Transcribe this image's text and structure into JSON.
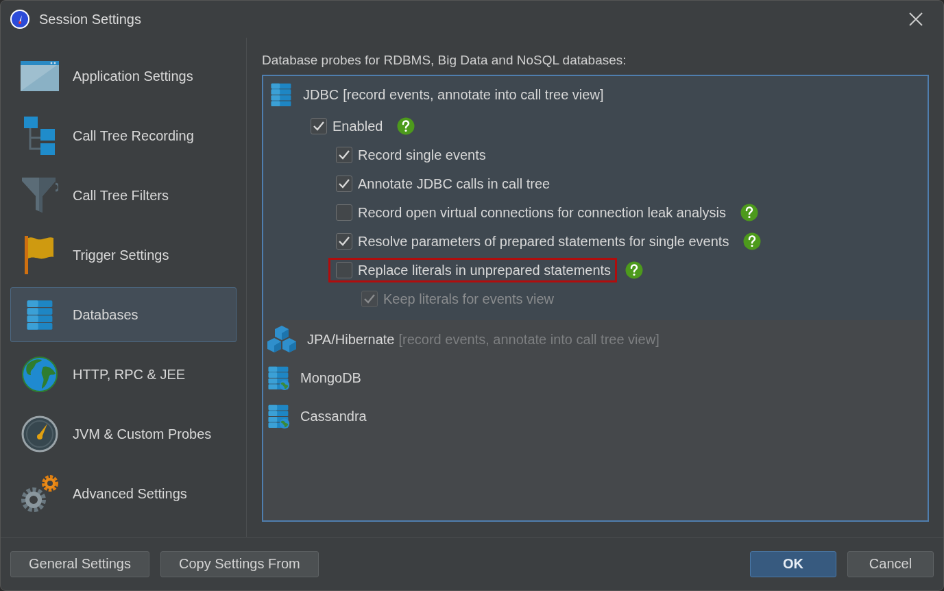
{
  "window": {
    "title": "Session Settings"
  },
  "sidebar": {
    "items": [
      {
        "label": "Application Settings",
        "kind": "window",
        "selected": false
      },
      {
        "label": "Call Tree Recording",
        "kind": "tree",
        "selected": false
      },
      {
        "label": "Call Tree Filters",
        "kind": "filter",
        "selected": false
      },
      {
        "label": "Trigger Settings",
        "kind": "flag",
        "selected": false
      },
      {
        "label": "Databases",
        "kind": "database",
        "selected": true
      },
      {
        "label": "HTTP, RPC & JEE",
        "kind": "globe",
        "selected": false
      },
      {
        "label": "JVM & Custom Probes",
        "kind": "gauge",
        "selected": false
      },
      {
        "label": "Advanced Settings",
        "kind": "gears",
        "selected": false
      }
    ]
  },
  "panel": {
    "heading": "Database probes for RDBMS, Big Data and NoSQL databases:",
    "probes": [
      {
        "kind": "database",
        "name": "JDBC",
        "note": "[record events, annotate into call tree view]",
        "expanded": true,
        "options": [
          {
            "label": "Enabled",
            "checked": true,
            "disabled": false,
            "help": true,
            "highlighted": false,
            "children": [
              {
                "label": "Record single events",
                "checked": true,
                "disabled": false,
                "help": false,
                "highlighted": false
              },
              {
                "label": "Annotate JDBC calls in call tree",
                "checked": true,
                "disabled": false,
                "help": false,
                "highlighted": false
              },
              {
                "label": "Record open virtual connections for connection leak analysis",
                "checked": false,
                "disabled": false,
                "help": true,
                "highlighted": false
              },
              {
                "label": "Resolve parameters of prepared statements for single events",
                "checked": true,
                "disabled": false,
                "help": true,
                "highlighted": false
              },
              {
                "label": "Replace literals in unprepared statements",
                "checked": false,
                "disabled": false,
                "help": true,
                "highlighted": true,
                "children": [
                  {
                    "label": "Keep literals for events view",
                    "checked": true,
                    "disabled": true,
                    "help": false,
                    "highlighted": false
                  }
                ]
              }
            ]
          }
        ]
      },
      {
        "kind": "cubes",
        "name": "JPA/Hibernate",
        "note": "[record events, annotate into call tree view]",
        "expanded": false
      },
      {
        "kind": "database-globe",
        "name": "MongoDB",
        "expanded": false
      },
      {
        "kind": "database-globe",
        "name": "Cassandra",
        "expanded": false
      }
    ]
  },
  "footer": {
    "left_buttons": [
      "General Settings",
      "Copy Settings From"
    ],
    "right_buttons": [
      {
        "label": "OK",
        "default": true
      },
      {
        "label": "Cancel",
        "default": false
      }
    ]
  }
}
